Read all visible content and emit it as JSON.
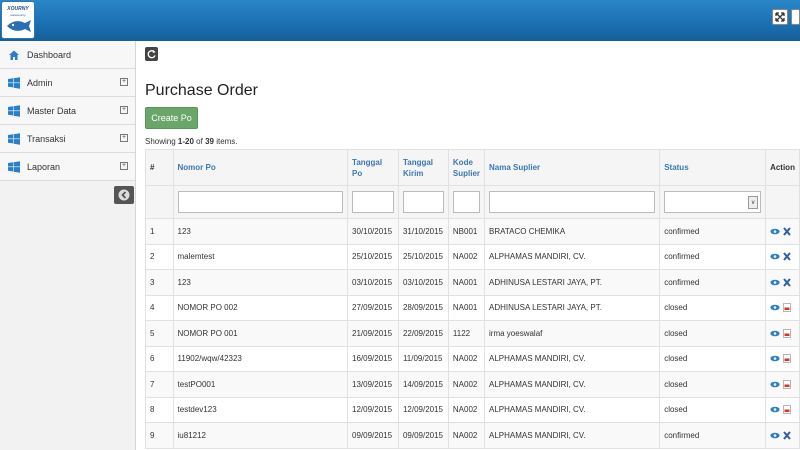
{
  "app": {
    "logo_text": "XOURNY",
    "logo_sub": "wwwxourny"
  },
  "sidebar": {
    "items": [
      {
        "label": "Dashboard",
        "icon": "home-icon",
        "expandable": false
      },
      {
        "label": "Admin",
        "icon": "windows-icon",
        "expandable": true
      },
      {
        "label": "Master Data",
        "icon": "windows-icon",
        "expandable": true
      },
      {
        "label": "Transaksi",
        "icon": "windows-icon",
        "expandable": true
      },
      {
        "label": "Laporan",
        "icon": "windows-icon",
        "expandable": true
      }
    ],
    "expand_glyph": "+"
  },
  "main": {
    "title": "Purchase Order",
    "create_label": "Create Po",
    "summary": {
      "prefix": "Showing ",
      "range": "1-20",
      "mid": " of ",
      "total": "39",
      "suffix": " items."
    }
  },
  "table": {
    "columns": [
      "#",
      "Nomor Po",
      "Tanggal Po",
      "Tanggal Kirim",
      "Kode Suplier",
      "Nama Suplier",
      "Status",
      "Action"
    ],
    "rows": [
      {
        "n": "1",
        "nomor": "123",
        "tgl_po": "30/10/2015",
        "tgl_kirim": "31/10/2015",
        "kode": "NB001",
        "nama": "BRATACO CHEMIKA",
        "status": "confirmed"
      },
      {
        "n": "2",
        "nomor": "malemtest",
        "tgl_po": "25/10/2015",
        "tgl_kirim": "25/10/2015",
        "kode": "NA002",
        "nama": "ALPHAMAS MANDIRI, CV.",
        "status": "confirmed"
      },
      {
        "n": "3",
        "nomor": "123",
        "tgl_po": "03/10/2015",
        "tgl_kirim": "03/10/2015",
        "kode": "NA001",
        "nama": "ADHINUSA LESTARI JAYA, PT.",
        "status": "confirmed"
      },
      {
        "n": "4",
        "nomor": "NOMOR PO 002",
        "tgl_po": "27/09/2015",
        "tgl_kirim": "28/09/2015",
        "kode": "NA001",
        "nama": "ADHINUSA LESTARI JAYA, PT.",
        "status": "closed"
      },
      {
        "n": "5",
        "nomor": "NOMOR PO 001",
        "tgl_po": "21/09/2015",
        "tgl_kirim": "22/09/2015",
        "kode": "1122",
        "nama": "irma yoeswalaf",
        "status": "closed"
      },
      {
        "n": "6",
        "nomor": "11902/wqw/42323",
        "tgl_po": "16/09/2015",
        "tgl_kirim": "11/09/2015",
        "kode": "NA002",
        "nama": "ALPHAMAS MANDIRI, CV.",
        "status": "closed"
      },
      {
        "n": "7",
        "nomor": "testPO001",
        "tgl_po": "13/09/2015",
        "tgl_kirim": "14/09/2015",
        "kode": "NA002",
        "nama": "ALPHAMAS MANDIRI, CV.",
        "status": "closed"
      },
      {
        "n": "8",
        "nomor": "testdev123",
        "tgl_po": "12/09/2015",
        "tgl_kirim": "12/09/2015",
        "kode": "NA002",
        "nama": "ALPHAMAS MANDIRI, CV.",
        "status": "closed"
      },
      {
        "n": "9",
        "nomor": "iu81212",
        "tgl_po": "09/09/2015",
        "tgl_kirim": "09/09/2015",
        "kode": "NA002",
        "nama": "ALPHAMAS MANDIRI, CV.",
        "status": "confirmed"
      }
    ]
  },
  "colors": {
    "topbar": "#1b6fb0",
    "link": "#3a78b5",
    "create_button": "#6aa56a"
  }
}
